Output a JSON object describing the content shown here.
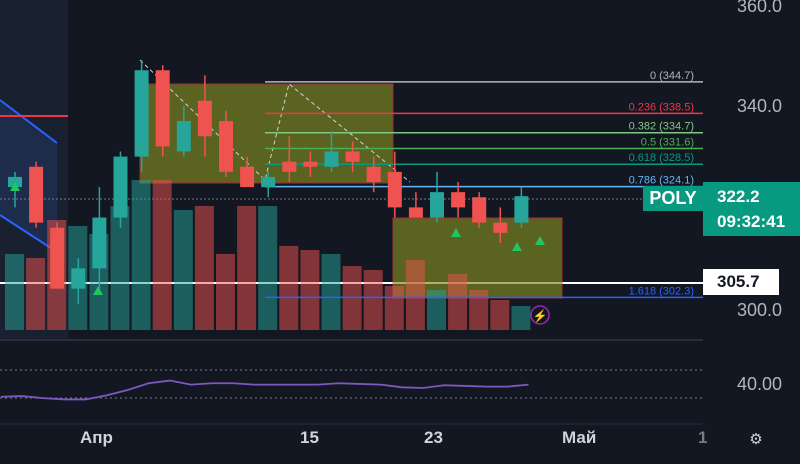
{
  "chart_data": {
    "type": "candlestick",
    "symbol": "POLY",
    "price_axis": {
      "ticks": [
        360.0,
        340.0,
        300.0
      ],
      "tick_labels": [
        "360.0",
        "340.0",
        "300.0"
      ]
    },
    "time_axis": {
      "labels": [
        "Апр",
        "15",
        "23",
        "Май",
        "1"
      ]
    },
    "last_price": "322.2",
    "countdown": "09:32:41",
    "marked_price": "305.7",
    "candles": [
      {
        "o": 326,
        "h": 327,
        "l": 320,
        "c": 324,
        "up": true
      },
      {
        "o": 328,
        "h": 329,
        "l": 316,
        "c": 317,
        "up": false
      },
      {
        "o": 316,
        "h": 317,
        "l": 304,
        "c": 304,
        "up": false
      },
      {
        "o": 304,
        "h": 310,
        "l": 301,
        "c": 308,
        "up": true
      },
      {
        "o": 308,
        "h": 324,
        "l": 304,
        "c": 318,
        "up": true
      },
      {
        "o": 318,
        "h": 331,
        "l": 316,
        "c": 330,
        "up": true
      },
      {
        "o": 330,
        "h": 349,
        "l": 327,
        "c": 347,
        "up": true
      },
      {
        "o": 347,
        "h": 348,
        "l": 330,
        "c": 332,
        "up": false
      },
      {
        "o": 331,
        "h": 340,
        "l": 330,
        "c": 337,
        "up": true
      },
      {
        "o": 341,
        "h": 346,
        "l": 330,
        "c": 334,
        "up": false
      },
      {
        "o": 337,
        "h": 339,
        "l": 326,
        "c": 327,
        "up": false
      },
      {
        "o": 328,
        "h": 330,
        "l": 324,
        "c": 324,
        "up": false
      },
      {
        "o": 324,
        "h": 327,
        "l": 322,
        "c": 326,
        "up": true
      },
      {
        "o": 327,
        "h": 334,
        "l": 325,
        "c": 329,
        "up": false
      },
      {
        "o": 329,
        "h": 331,
        "l": 326,
        "c": 328,
        "up": false
      },
      {
        "o": 328,
        "h": 335,
        "l": 327,
        "c": 331,
        "up": true
      },
      {
        "o": 331,
        "h": 333,
        "l": 327,
        "c": 329,
        "up": false
      },
      {
        "o": 328,
        "h": 330,
        "l": 323,
        "c": 325,
        "up": false
      },
      {
        "o": 327,
        "h": 331,
        "l": 318,
        "c": 320,
        "up": false
      },
      {
        "o": 320,
        "h": 323,
        "l": 318,
        "c": 318,
        "up": false
      },
      {
        "o": 318,
        "h": 327,
        "l": 317,
        "c": 323,
        "up": true
      },
      {
        "o": 323,
        "h": 325,
        "l": 318,
        "c": 320,
        "up": false
      },
      {
        "o": 322,
        "h": 323,
        "l": 316,
        "c": 317,
        "up": false
      },
      {
        "o": 317,
        "h": 320,
        "l": 313,
        "c": 315,
        "up": false
      },
      {
        "o": 317,
        "h": 324,
        "l": 316,
        "c": 322.2,
        "up": true
      }
    ],
    "volume": [
      0.38,
      0.36,
      0.55,
      0.52,
      0.48,
      0.62,
      0.75,
      0.75,
      0.6,
      0.62,
      0.38,
      0.62,
      0.62,
      0.42,
      0.4,
      0.38,
      0.32,
      0.3,
      0.22,
      0.35,
      0.2,
      0.28,
      0.2,
      0.15,
      0.12
    ],
    "fibonacci": [
      {
        "label": "0 (344.7)",
        "price": 344.7,
        "color": "#b2b5be"
      },
      {
        "label": "0.236 (338.5)",
        "price": 338.5,
        "color": "#f23645"
      },
      {
        "label": "0.382 (334.7)",
        "price": 334.7,
        "color": "#81c784"
      },
      {
        "label": "0.5 (331.6)",
        "price": 331.6,
        "color": "#4caf50"
      },
      {
        "label": "0.618 (328.5)",
        "price": 328.5,
        "color": "#089981"
      },
      {
        "label": "0.786 (324.1)",
        "price": 324.1,
        "color": "#64b5f6"
      },
      {
        "label": "1.618 (302.3)",
        "price": 302.3,
        "color": "#2962ff"
      }
    ],
    "oscillator": {
      "ticks": [
        "40.00"
      ],
      "values": [
        35,
        35.5,
        34,
        33,
        33,
        36,
        40,
        45,
        47,
        44,
        45,
        45,
        44,
        44,
        44,
        44,
        45,
        44.5,
        44,
        42,
        41.5,
        43.5,
        43,
        42.5,
        42.5,
        44
      ]
    }
  },
  "colors": {
    "up": "#26a69a",
    "down": "#ef5350",
    "background": "#131722",
    "box_fill": "#828c1f"
  }
}
